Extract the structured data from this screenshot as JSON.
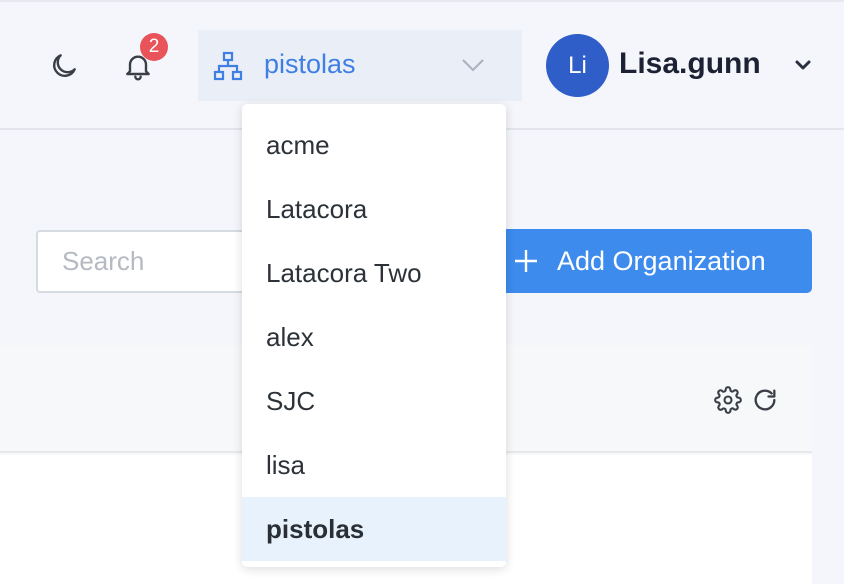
{
  "header": {
    "notification_count": "2",
    "org_selector": {
      "value": "pistolas"
    },
    "user": {
      "initials": "Li",
      "name": "Lisa.gunn"
    }
  },
  "search": {
    "placeholder": "Search"
  },
  "add_button": {
    "label": "Add Organization"
  },
  "org_dropdown": {
    "items": [
      "acme",
      "Latacora",
      "Latacora Two",
      "alex",
      "SJC",
      "lisa",
      "pistolas"
    ],
    "selected": "pistolas"
  },
  "icons": {
    "theme": "moon-icon",
    "notifications": "bell-icon",
    "org": "sitemap-icon",
    "settings": "gear-icon",
    "refresh": "refresh-icon"
  },
  "colors": {
    "accent": "#3d8bed",
    "link": "#3f7fe3",
    "avatar": "#2f5ec8",
    "badge": "#e8545a",
    "selected_bg": "#e7f2fc"
  }
}
